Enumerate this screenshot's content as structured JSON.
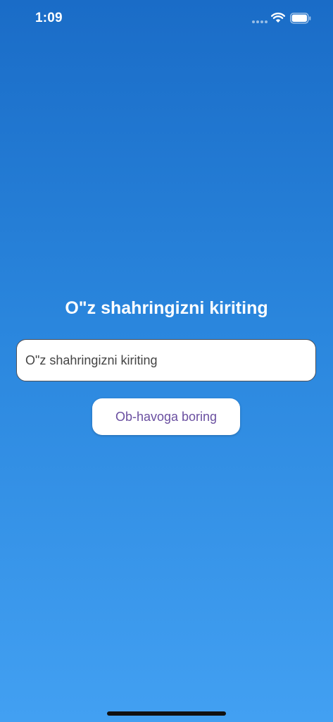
{
  "status_bar": {
    "time": "1:09"
  },
  "main": {
    "title": "O\"z shahringizni kiriting",
    "city_input": {
      "value": "",
      "placeholder": "O\"z shahringizni kiriting"
    },
    "go_button_label": "Ob-havoga boring"
  },
  "colors": {
    "gradient_top": "#1a6cc7",
    "gradient_bottom": "#42a0f2",
    "button_text": "#6a4fa0"
  },
  "icons": [
    "signal-dots-icon",
    "wifi-icon",
    "battery-icon"
  ]
}
